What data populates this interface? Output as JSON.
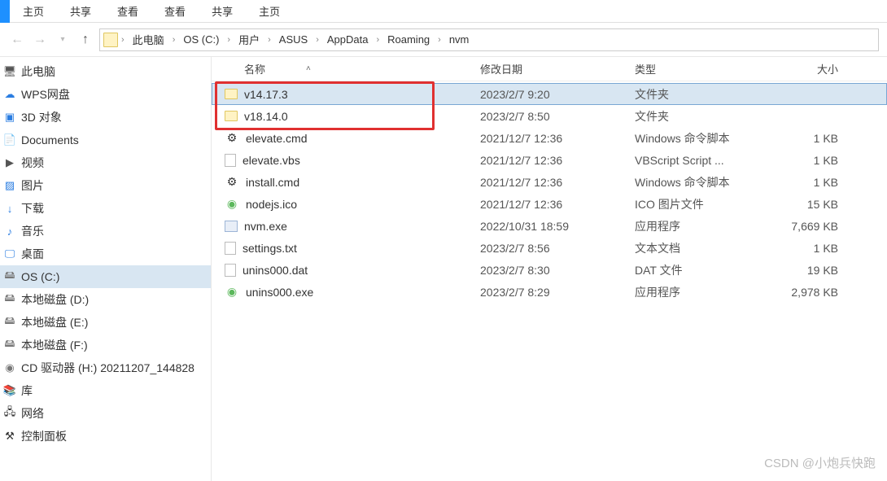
{
  "ribbon": {
    "tabs": [
      "主页",
      "共享",
      "查看"
    ]
  },
  "breadcrumb": [
    "此电脑",
    "OS (C:)",
    "用户",
    "ASUS",
    "AppData",
    "Roaming",
    "nvm"
  ],
  "sidebar": {
    "items": [
      {
        "label": "此电脑",
        "icon": "pc",
        "selected": false
      },
      {
        "label": "WPS网盘",
        "icon": "cloud",
        "selected": false
      },
      {
        "label": "3D 对象",
        "icon": "cube",
        "selected": false
      },
      {
        "label": "Documents",
        "icon": "doc",
        "selected": false
      },
      {
        "label": "视频",
        "icon": "video",
        "selected": false
      },
      {
        "label": "图片",
        "icon": "pic",
        "selected": false
      },
      {
        "label": "下载",
        "icon": "down",
        "selected": false
      },
      {
        "label": "音乐",
        "icon": "music",
        "selected": false
      },
      {
        "label": "桌面",
        "icon": "desk",
        "selected": false
      },
      {
        "label": "OS (C:)",
        "icon": "disk",
        "selected": true
      },
      {
        "label": "本地磁盘 (D:)",
        "icon": "disk",
        "selected": false
      },
      {
        "label": "本地磁盘 (E:)",
        "icon": "disk",
        "selected": false
      },
      {
        "label": "本地磁盘 (F:)",
        "icon": "disk",
        "selected": false
      },
      {
        "label": "CD 驱动器 (H:) 20211207_144828",
        "icon": "cd",
        "selected": false
      },
      {
        "label": "库",
        "icon": "lib",
        "selected": false
      },
      {
        "label": "网络",
        "icon": "net",
        "selected": false
      },
      {
        "label": "控制面板",
        "icon": "panel",
        "selected": false
      }
    ]
  },
  "columns": {
    "name": "名称",
    "date": "修改日期",
    "type": "类型",
    "size": "大小"
  },
  "files": [
    {
      "name": "v14.17.3",
      "date": "2023/2/7 9:20",
      "type": "文件夹",
      "size": "",
      "icon": "folder",
      "selected": true
    },
    {
      "name": "v18.14.0",
      "date": "2023/2/7 8:50",
      "type": "文件夹",
      "size": "",
      "icon": "folder",
      "selected": false
    },
    {
      "name": "elevate.cmd",
      "date": "2021/12/7 12:36",
      "type": "Windows 命令脚本",
      "size": "1 KB",
      "icon": "gear",
      "selected": false
    },
    {
      "name": "elevate.vbs",
      "date": "2021/12/7 12:36",
      "type": "VBScript Script ...",
      "size": "1 KB",
      "icon": "file",
      "selected": false
    },
    {
      "name": "install.cmd",
      "date": "2021/12/7 12:36",
      "type": "Windows 命令脚本",
      "size": "1 KB",
      "icon": "gear",
      "selected": false
    },
    {
      "name": "nodejs.ico",
      "date": "2021/12/7 12:36",
      "type": "ICO 图片文件",
      "size": "15 KB",
      "icon": "ico-green",
      "selected": false
    },
    {
      "name": "nvm.exe",
      "date": "2022/10/31 18:59",
      "type": "应用程序",
      "size": "7,669 KB",
      "icon": "exe",
      "selected": false
    },
    {
      "name": "settings.txt",
      "date": "2023/2/7 8:56",
      "type": "文本文档",
      "size": "1 KB",
      "icon": "file",
      "selected": false
    },
    {
      "name": "unins000.dat",
      "date": "2023/2/7 8:30",
      "type": "DAT 文件",
      "size": "19 KB",
      "icon": "file",
      "selected": false
    },
    {
      "name": "unins000.exe",
      "date": "2023/2/7 8:29",
      "type": "应用程序",
      "size": "2,978 KB",
      "icon": "ico-green",
      "selected": false
    }
  ],
  "highlight_box_rows": 2,
  "watermark": "CSDN @小炮兵快跑"
}
